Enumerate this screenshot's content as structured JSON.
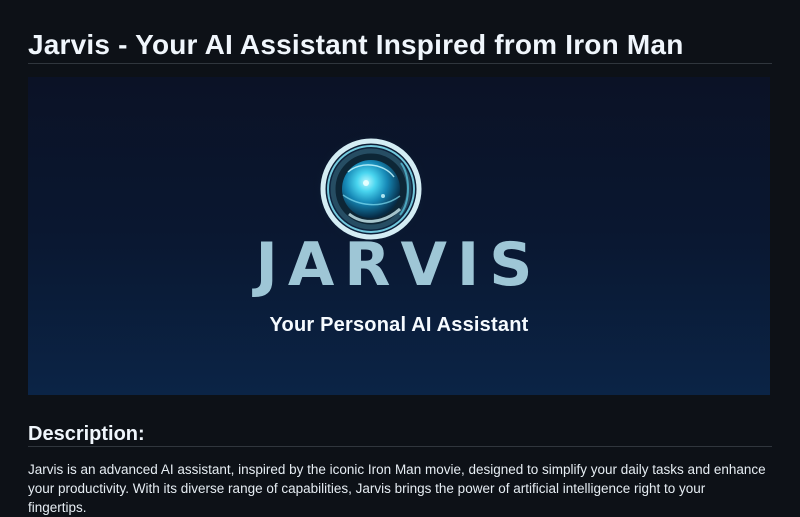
{
  "page": {
    "title": "Jarvis - Your AI Assistant Inspired from Iron Man"
  },
  "banner": {
    "brand": "JARVIS",
    "tagline": "Your Personal AI Assistant",
    "icon": "ai-orb-icon",
    "colors": {
      "background_top": "#0b1226",
      "background_bottom": "#0b2446",
      "brand_text": "#9ec6d6",
      "tagline_text": "#f6fbff"
    }
  },
  "description": {
    "heading": "Description:",
    "body": "Jarvis is an advanced AI assistant, inspired by the iconic Iron Man movie, designed to simplify your daily tasks and enhance your productivity. With its diverse range of capabilities, Jarvis brings the power of artificial intelligence right to your fingertips."
  },
  "theme": {
    "background": "#0d1117",
    "text": "#e6edf3",
    "divider": "#30363d"
  }
}
